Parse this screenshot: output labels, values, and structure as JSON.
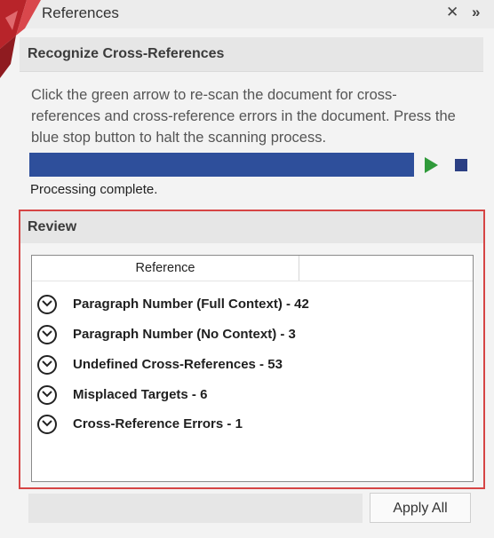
{
  "window": {
    "title": "References",
    "close_glyph": "✕",
    "expand_glyph": "»"
  },
  "recognize": {
    "header": "Recognize Cross-References",
    "description": "Click the green arrow to re-scan the document for cross-references and cross-reference errors in the document. Press the blue stop button to halt the scanning process.",
    "status": "Processing complete.",
    "progress_fraction": 1.0
  },
  "review": {
    "header": "Review",
    "column_header": "Reference",
    "items": [
      {
        "label": "Paragraph Number (Full Context) - 42"
      },
      {
        "label": "Paragraph Number (No Context) - 3"
      },
      {
        "label": "Undefined Cross-References - 53"
      },
      {
        "label": "Misplaced Targets - 6"
      },
      {
        "label": "Cross-Reference Errors - 1"
      }
    ]
  },
  "footer": {
    "apply_all": "Apply All"
  },
  "colors": {
    "progress": "#2e4f9b",
    "play": "#2f9a3a",
    "stop": "#2b3f83",
    "highlight_border": "#d64545"
  }
}
